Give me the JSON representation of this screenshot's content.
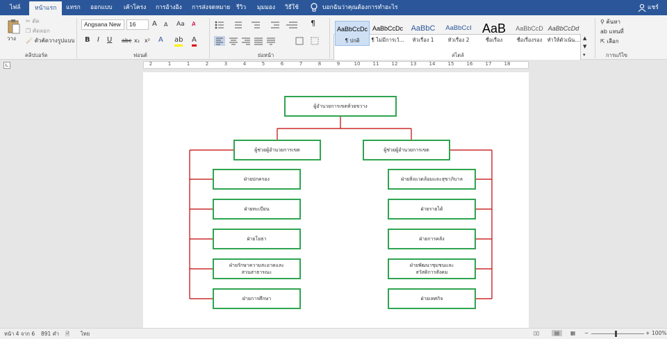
{
  "tabs": [
    "ไฟล์",
    "หน้าแรก",
    "แทรก",
    "ออกแบบ",
    "เค้าโครง",
    "การอ้างอิง",
    "การส่งจดหมาย",
    "รีวิว",
    "มุมมอง",
    "วิธีใช้"
  ],
  "tell_me": "บอกฉันว่าคุณต้องการทำอะไร",
  "user": "แชร์",
  "clipboard": {
    "paste": "วาง",
    "cut": "ตัด",
    "copy": "คัดลอก",
    "format_painter": "ตัวคัดวางรูปแบบ",
    "label": "คลิปบอร์ด"
  },
  "font": {
    "name": "Angsana New",
    "size": "16",
    "grow": "A",
    "shrink": "A",
    "case": "Aa",
    "bold": "B",
    "italic": "I",
    "underline": "U",
    "strike": "abc",
    "subscript": "x₂",
    "superscript": "x²",
    "label": "ฟอนต์"
  },
  "paragraph": {
    "label": "ย่อหน้า",
    "pilcrow": "¶"
  },
  "styles": {
    "label": "สไตล์",
    "items": [
      {
        "preview": "AaBbCcDc",
        "name": "¶ ปกติ"
      },
      {
        "preview": "AaBbCcDc",
        "name": "¶ ไม่มีการเว้..."
      },
      {
        "preview": "AaBbC",
        "name": "หัวเรื่อง 1"
      },
      {
        "preview": "AaBbCcI",
        "name": "หัวเรื่อง 2"
      },
      {
        "preview": "AaB",
        "name": "ชื่อเรื่อง"
      },
      {
        "preview": "AaBbCcD",
        "name": "ชื่อเรื่องรอง"
      },
      {
        "preview": "AaBbCcDd",
        "name": "ทำให้ตัวเน้น..."
      }
    ]
  },
  "editing": {
    "find": "ค้นหา",
    "replace": "แทนที่",
    "select": "เลือก",
    "label": "การแก้ไข"
  },
  "ruler_numbers": [
    "2",
    "1",
    "1",
    "2",
    "3",
    "4",
    "5",
    "6",
    "7",
    "8",
    "9",
    "10",
    "11",
    "12",
    "13",
    "14",
    "15",
    "16",
    "17",
    "18"
  ],
  "chart": {
    "top": "ผู้อำนวยการเขตห้วยขวาง",
    "left_deputy": "ผู้ช่วยผู้อำนวยการเขต",
    "right_deputy": "ผู้ช่วยผู้อำนวยการเขต",
    "left_items": [
      "ฝ่ายปกครอง",
      "ฝ่ายทะเบียน",
      "ฝ่ายโยธา",
      "ฝ่ายรักษาความสะอาดและ\nสวนสาธารณะ",
      "ฝ่ายการศึกษา"
    ],
    "right_items": [
      "ฝ่ายสิ่งแวดล้อมและสุขาภิบาล",
      "ฝ่ายรายได้",
      "ฝ่ายการคลัง",
      "ฝ่ายพัฒนาชุมชนและ\nสวัสดิการสังคม",
      "ฝ่ายเทศกิจ"
    ]
  },
  "status": {
    "page": "หน้า 4 จาก 6",
    "words": "891 คำ",
    "lang": "ไทย",
    "zoom": "100%"
  },
  "colors": {
    "tab_bar": "#2b579a",
    "box_border": "#2ea44f",
    "connector": "#c00000"
  }
}
